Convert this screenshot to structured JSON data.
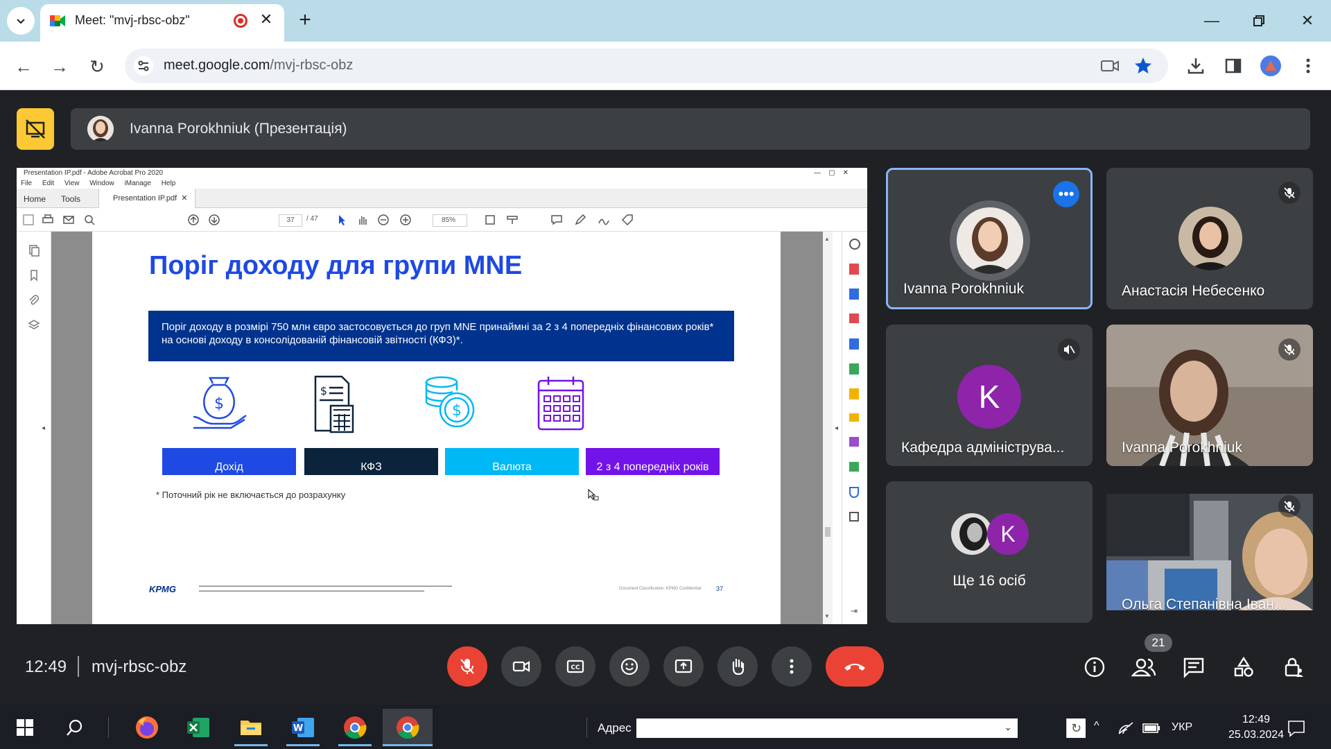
{
  "browser": {
    "tab_title": "Meet: \"mvj-rbsc-obz\"",
    "url_host": "meet.google.com",
    "url_path": "/mvj-rbsc-obz"
  },
  "presenter": {
    "label": "Ivanna Porokhniuk (Презентація)"
  },
  "acrobat": {
    "window_title": "Presentation IP.pdf - Adobe Acrobat Pro 2020",
    "menu": [
      "File",
      "Edit",
      "View",
      "Window",
      "iManage",
      "Help"
    ],
    "tab_home": "Home",
    "tab_tools": "Tools",
    "doc_tab": "Presentation IP.pdf",
    "page_current": "37",
    "page_total": "/ 47",
    "zoom": "85%"
  },
  "slide": {
    "title": "Поріг доходу для групи MNE",
    "box_text": "Поріг доходу в розмірі 750 млн євро застосовується до груп MNE принаймні за 2 з 4 попередніх фінансових років* на основі доходу в консолідованій фінансовій звітності (КФЗ)*.",
    "labels": [
      "Дохід",
      "КФЗ",
      "Валюта",
      "2 з 4 попередніх років"
    ],
    "label_colors": [
      "#1e49e2",
      "#0c233c",
      "#00b8f5",
      "#7213ea"
    ],
    "note": "* Поточний рік не включається до розрахунку",
    "logo": "KPMG",
    "classification": "Document Classification: KPMG Confidential",
    "page_number": "37"
  },
  "participants": [
    {
      "name": "Ivanna Porokhniuk",
      "active": true
    },
    {
      "name": "Анастасія Небесенко",
      "muted": true
    },
    {
      "name": "Кафедра адмініструва...",
      "initial": "K",
      "muted": true
    },
    {
      "name": "Ivanna Porokhniuk",
      "muted": true
    },
    {
      "name": "Ще 16 осіб",
      "initial": "K"
    },
    {
      "name": "Ольга Степанівна Іван...",
      "muted": true
    }
  ],
  "meeting": {
    "time": "12:49",
    "code": "mvj-rbsc-obz",
    "people_count": "21"
  },
  "taskbar": {
    "address_label": "Адрес",
    "language": "УКР",
    "time": "12:49",
    "date": "25.03.2024"
  },
  "colors": {
    "meet_bg": "#202124",
    "tile_bg": "#3c4043",
    "end_call": "#ea4335",
    "present_btn": "#fcc934",
    "active_border": "#8ab4f8"
  }
}
